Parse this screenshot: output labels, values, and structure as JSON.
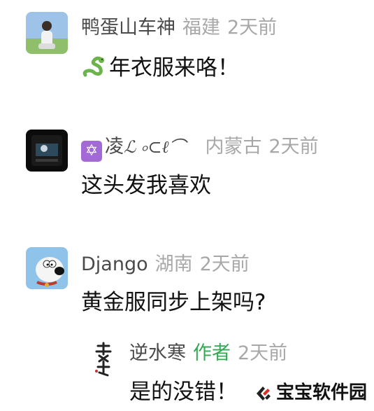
{
  "comments": [
    {
      "username": "鸭蛋山车神",
      "location": "福建",
      "time": "2天前",
      "text": "年衣服来咯！",
      "lead_icon": "snake-emoji-icon"
    },
    {
      "username": "凌",
      "username_suffix": "ℒ ৹⊂ℓ⌒",
      "location": "内蒙古",
      "time": "2天前",
      "text": "这头发我喜欢",
      "lead_icon": "star-of-david-emoji-icon"
    },
    {
      "username": "Django",
      "location": "湖南",
      "time": "2天前",
      "text": "黄金服同步上架吗?"
    }
  ],
  "reply": {
    "username": "逆水寒",
    "author_label": "作者",
    "time": "2天前",
    "text": "是的没错！"
  },
  "watermark": {
    "text": "宝宝软件园"
  },
  "colors": {
    "username": "#4a4a4a",
    "meta": "#a8a8a8",
    "author": "#34a853",
    "watermark_logo": "#d93025"
  }
}
